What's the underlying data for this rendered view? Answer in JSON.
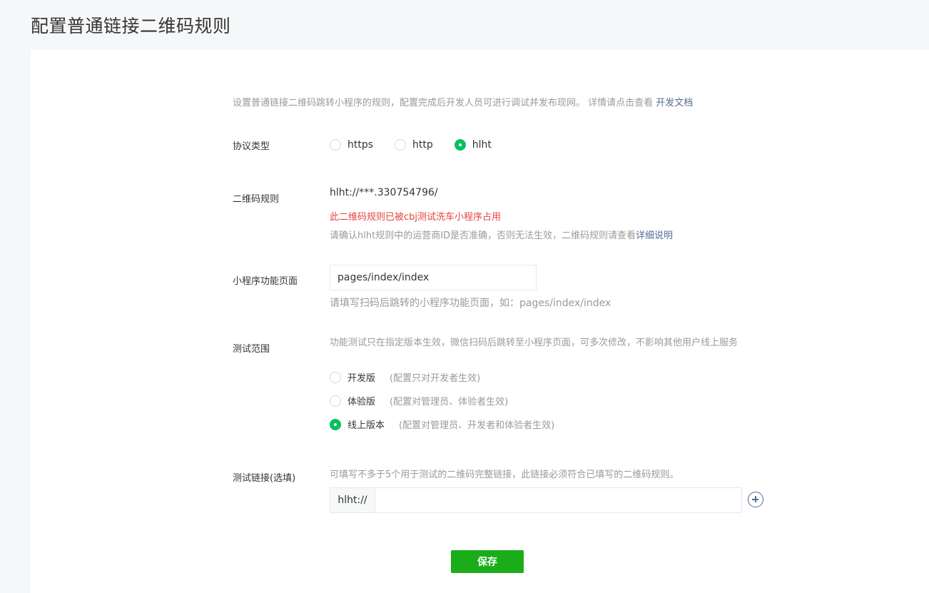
{
  "page": {
    "title": "配置普通链接二维码规则"
  },
  "intro": {
    "text": "设置普通链接二维码跳转小程序的规则，配置完成后开发人员可进行调试并发布现网。 详情请点击查看 ",
    "link": "开发文档"
  },
  "protocol": {
    "label": "协议类型",
    "options": [
      {
        "label": "https",
        "checked": false
      },
      {
        "label": "http",
        "checked": false
      },
      {
        "label": "hlht",
        "checked": true
      }
    ]
  },
  "qr_rule": {
    "label": "二维码规则",
    "value": "hlht://***.330754796/",
    "error": "此二维码规则已被cbj测试洗车小程序占用",
    "tip": "请确认hlht规则中的运营商ID是否准确，否则无法生效，二维码规则请查看",
    "tip_link": "详细说明"
  },
  "page_path": {
    "label": "小程序功能页面",
    "value": "pages/index/index",
    "hint": "请填写扫码后跳转的小程序功能页面，如：pages/index/index"
  },
  "test_scope": {
    "label": "测试范围",
    "description": "功能测试只在指定版本生效，微信扫码后跳转至小程序页面，可多次修改，不影响其他用户线上服务",
    "options": [
      {
        "label": "开发版",
        "note": "(配置只对开发者生效)",
        "checked": false
      },
      {
        "label": "体验版",
        "note": "(配置对管理员、体验者生效)",
        "checked": false
      },
      {
        "label": "线上版本",
        "note": "(配置对管理员、开发者和体验者生效)",
        "checked": true
      }
    ]
  },
  "test_links": {
    "label": "测试链接(选填)",
    "description": "可填写不多于5个用于测试的二维码完整链接，此链接必须符合已填写的二维码规则。",
    "prefix": "hlht://",
    "value": ""
  },
  "actions": {
    "save": "保存"
  },
  "colors": {
    "primary": "#1aad19",
    "checked": "#07c160",
    "link": "#576b95",
    "error": "#e64340"
  }
}
